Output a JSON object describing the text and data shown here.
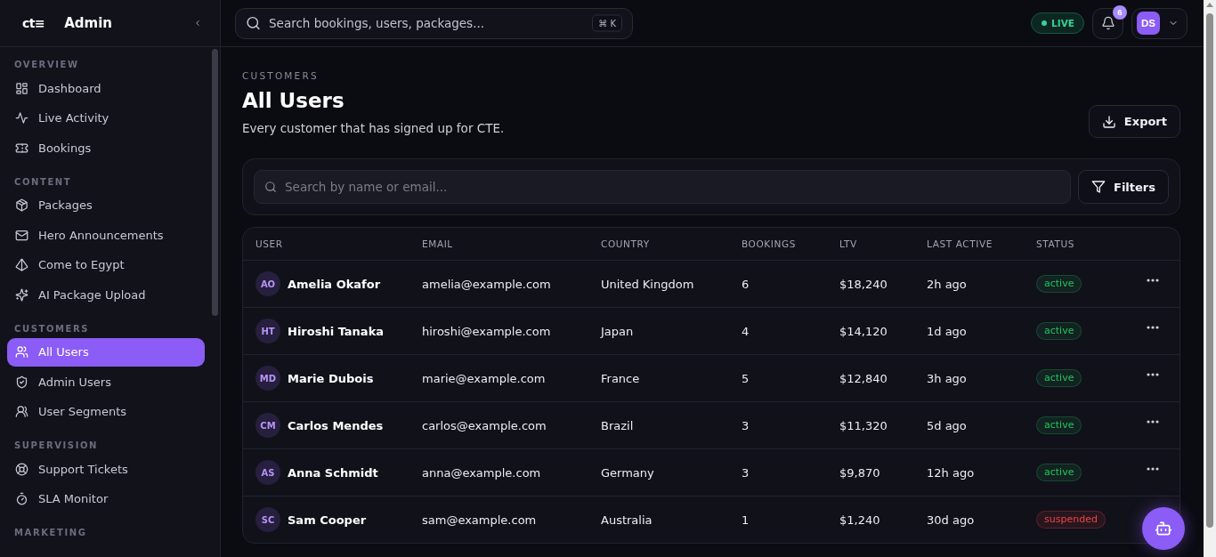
{
  "sidebar": {
    "logo": "ct≡",
    "title": "Admin",
    "sections": [
      {
        "label": "OVERVIEW",
        "items": [
          {
            "label": "Dashboard",
            "selected": false
          },
          {
            "label": "Live Activity",
            "selected": false
          },
          {
            "label": "Bookings",
            "selected": false
          }
        ]
      },
      {
        "label": "CONTENT",
        "items": [
          {
            "label": "Packages",
            "selected": false
          },
          {
            "label": "Hero Announcements",
            "selected": false
          },
          {
            "label": "Come to Egypt",
            "selected": false
          },
          {
            "label": "AI Package Upload",
            "selected": false
          }
        ]
      },
      {
        "label": "CUSTOMERS",
        "items": [
          {
            "label": "All Users",
            "selected": true
          },
          {
            "label": "Admin Users",
            "selected": false
          },
          {
            "label": "User Segments",
            "selected": false
          }
        ]
      },
      {
        "label": "SUPERVISION",
        "items": [
          {
            "label": "Support Tickets",
            "selected": false
          },
          {
            "label": "SLA Monitor",
            "selected": false
          }
        ]
      },
      {
        "label": "MARKETING"
      }
    ]
  },
  "topbar": {
    "search": {
      "placeholder": "Search bookings, users, packages...",
      "shortcut": "⌘ K"
    },
    "live_badge": "LIVE",
    "notification_count": "6",
    "avatar_initials": "DS"
  },
  "page": {
    "eyebrow": "CUSTOMERS",
    "title": "All Users",
    "subtitle": "Every customer that has signed up for CTE.",
    "export_button": "Export"
  },
  "filter_bar": {
    "search": {
      "placeholder": "Search by name or email..."
    },
    "filters_button": "Filters"
  },
  "table": {
    "columns": [
      "USER",
      "EMAIL",
      "COUNTRY",
      "BOOKINGS",
      "LTV",
      "LAST ACTIVE",
      "STATUS"
    ],
    "rows": [
      {
        "initials": "AO",
        "name": "Amelia Okafor",
        "email": "amelia@example.com",
        "country": "United Kingdom",
        "bookings": "6",
        "ltv": "$18,240",
        "last_active": "2h ago",
        "status": {
          "label": "active",
          "color": "#22c55e"
        },
        "menu": true
      },
      {
        "initials": "HT",
        "name": "Hiroshi Tanaka",
        "email": "hiroshi@example.com",
        "country": "Japan",
        "bookings": "4",
        "ltv": "$14,120",
        "last_active": "1d ago",
        "status": {
          "label": "active",
          "color": "#22c55e"
        },
        "menu": true
      },
      {
        "initials": "MD",
        "name": "Marie Dubois",
        "email": "marie@example.com",
        "country": "France",
        "bookings": "5",
        "ltv": "$12,840",
        "last_active": "3h ago",
        "status": {
          "label": "active",
          "color": "#22c55e"
        },
        "menu": true
      },
      {
        "initials": "CM",
        "name": "Carlos Mendes",
        "email": "carlos@example.com",
        "country": "Brazil",
        "bookings": "3",
        "ltv": "$11,320",
        "last_active": "5d ago",
        "status": {
          "label": "active",
          "color": "#22c55e"
        },
        "menu": true
      },
      {
        "initials": "AS",
        "name": "Anna Schmidt",
        "email": "anna@example.com",
        "country": "Germany",
        "bookings": "3",
        "ltv": "$9,870",
        "last_active": "12h ago",
        "status": {
          "label": "active",
          "color": "#22c55e"
        },
        "menu": true
      },
      {
        "initials": "SC",
        "name": "Sam Cooper",
        "email": "sam@example.com",
        "country": "Australia",
        "bookings": "1",
        "ltv": "$1,240",
        "last_active": "30d ago",
        "status": {
          "label": "suspended",
          "color": "#ef4444"
        },
        "menu": false
      }
    ]
  }
}
